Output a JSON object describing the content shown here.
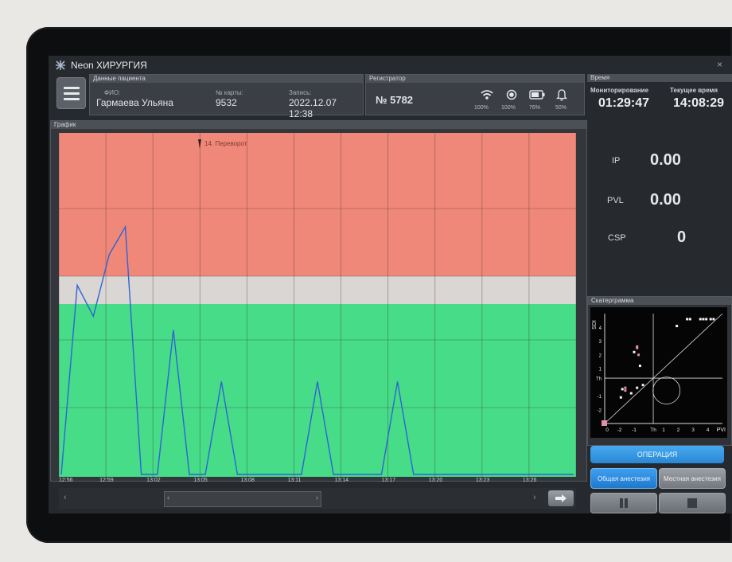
{
  "app": {
    "title": "Neon ХИРУРГИЯ",
    "close_glyph": "×"
  },
  "patient": {
    "section": "Данные пациента",
    "name_label": "ФИО:",
    "name": "Гармаева Ульяна",
    "card_label": "№ карты:",
    "card": "9532",
    "record_label": "Запись:",
    "record": "2022.12.07 12:38"
  },
  "recorder": {
    "section": "Регистратор",
    "number": "№ 5782",
    "statuses": [
      {
        "icon": "wifi-icon",
        "value": "100%"
      },
      {
        "icon": "record-icon",
        "value": "100%"
      },
      {
        "icon": "battery-icon",
        "value": "76%"
      },
      {
        "icon": "bell-icon",
        "value": "50%"
      }
    ]
  },
  "time": {
    "section": "Время",
    "monitoring_label": "Мониторирование",
    "monitoring": "01:29:47",
    "current_label": "Текущее время",
    "current": "14:08:29"
  },
  "graph": {
    "section": "График",
    "event_marker": "14. Переворот",
    "x_ticks": [
      "12:56",
      "12:59",
      "13:02",
      "13:05",
      "13:08",
      "13:11",
      "13:14",
      "13:17",
      "13:20",
      "13:23",
      "13:26"
    ]
  },
  "chart_data": {
    "type": "line",
    "x": [
      "12:56",
      "12:57",
      "12:58",
      "12:59",
      "13:00",
      "13:01",
      "13:02",
      "13:03",
      "13:04",
      "13:05",
      "13:06",
      "13:07",
      "13:08",
      "13:09",
      "13:10",
      "13:11",
      "13:12",
      "13:13",
      "13:14",
      "13:15",
      "13:16",
      "13:17",
      "13:18",
      "13:19",
      "13:20",
      "13:21",
      "13:22",
      "13:23",
      "13:24",
      "13:25",
      "13:26",
      "13:27",
      "13:28"
    ],
    "series": [
      {
        "values": [
          0,
          0.55,
          0.46,
          0.64,
          0.72,
          0,
          0,
          0.42,
          0,
          0,
          0.27,
          0,
          0,
          0,
          0,
          0,
          0.27,
          0,
          0,
          0,
          0,
          0.27,
          0,
          0,
          0,
          0,
          0,
          0,
          0,
          0,
          0,
          0,
          0
        ]
      }
    ],
    "zones": [
      {
        "color": "#ef8878",
        "from": 0.58,
        "to": 1.0
      },
      {
        "color": "#d9d6d4",
        "from": 0.5,
        "to": 0.58
      },
      {
        "color": "#46dc88",
        "from": 0.0,
        "to": 0.5
      }
    ],
    "line_color": "#2f63d8"
  },
  "metrics": [
    {
      "name": "IP",
      "value": "0.00"
    },
    {
      "name": "PVL",
      "value": "0.00"
    },
    {
      "name": "CSP",
      "value": "0"
    }
  ],
  "scatter": {
    "section": "Скатерграмма",
    "y_label": "SDI",
    "x_label": "PVI",
    "y_ticks": [
      "4",
      "3",
      "2",
      "1",
      "Th",
      "-1",
      "-2"
    ],
    "x_ticks": [
      "0",
      "-2",
      "-1",
      "Th",
      "1",
      "2",
      "3",
      "4"
    ]
  },
  "scatter_data": {
    "type": "scatter",
    "series": [
      {
        "name": "white",
        "color": "#f2f2f2",
        "points": [
          [
            2.6,
            4.6
          ],
          [
            2.8,
            4.6
          ],
          [
            3.5,
            4.6
          ],
          [
            3.7,
            4.6
          ],
          [
            3.9,
            4.6
          ],
          [
            4.2,
            4.6
          ],
          [
            4.4,
            4.6
          ],
          [
            1.9,
            4.1
          ],
          [
            -1.0,
            2.2
          ],
          [
            -0.6,
            1.2
          ],
          [
            -1.8,
            -0.5
          ],
          [
            -1.2,
            -0.8
          ],
          [
            -0.8,
            -0.4
          ],
          [
            -0.4,
            -0.2
          ],
          [
            -1.9,
            -1.1
          ]
        ]
      },
      {
        "name": "pink",
        "color": "#e38fb0",
        "points": [
          [
            -0.8,
            2.6
          ],
          [
            -0.8,
            2.5
          ],
          [
            -1.6,
            -0.4
          ],
          [
            -1.6,
            -0.6
          ],
          [
            -0.7,
            2.0
          ]
        ]
      }
    ]
  },
  "buttons": {
    "operation": "ОПЕРАЦИЯ",
    "general": "Общая анестезия",
    "local": "Местная анестезия"
  },
  "scrollbar": {
    "left_arrow": "‹",
    "right_arrow": "›",
    "thumb_left": "‹",
    "thumb_right": "›"
  },
  "colors": {
    "accent_blue": "#2888d6"
  }
}
